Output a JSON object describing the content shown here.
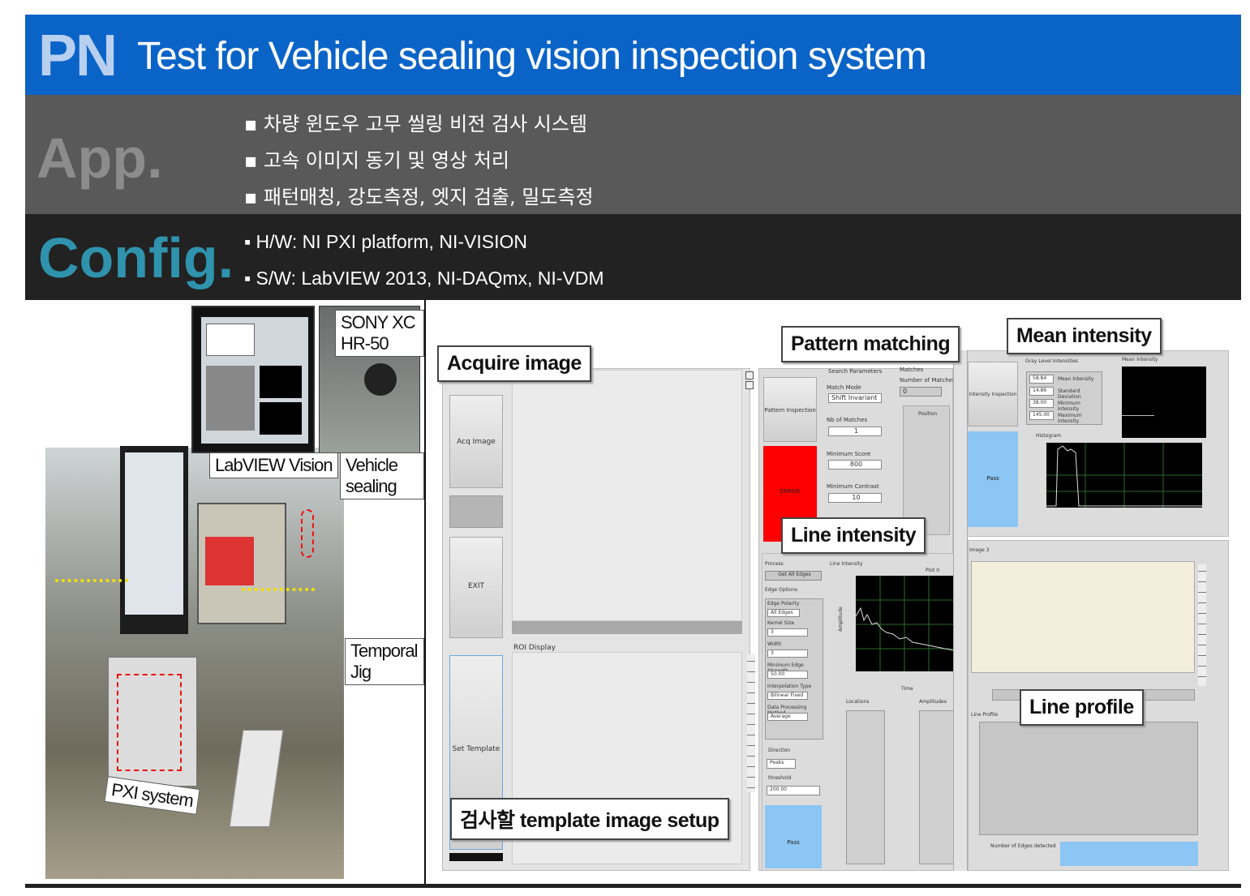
{
  "header": {
    "code": "PN",
    "title": "Test for Vehicle sealing vision inspection system"
  },
  "app": {
    "label": "App.",
    "items": [
      "▪ 차량 윈도우 고무 씰링 비전 검사 시스템",
      "▪ 고속 이미지 동기 및 영상 처리",
      "▪ 패턴매칭, 강도측정, 엣지 검출, 밀도측정"
    ]
  },
  "config": {
    "label": "Config.",
    "items": [
      "▪ H/W: NI PXI platform, NI-VISION",
      "▪ S/W: LabVIEW 2013, NI-DAQmx, NI-VDM"
    ]
  },
  "photo": {
    "callouts": {
      "camera": "SONY XC HR-50",
      "labview": "LabVIEW Vision",
      "sealing": "Vehicle sealing",
      "jig": "Temporal Jig",
      "pxi": "PXI system"
    }
  },
  "screen": {
    "callouts": {
      "acquire": "Acquire image",
      "pattern": "Pattern matching",
      "mean": "Mean intensity",
      "line": "Line intensity",
      "profile": "Line profile",
      "template": "검사할 template image setup"
    },
    "buttons": {
      "acq": "Acq Image",
      "exit": "EXIT",
      "set_template": "Set Template",
      "pattern_inspection": "Pattern Inspection",
      "intensity_inspection": "Intensity Inspection",
      "error": "ERROR",
      "pass": "Pass",
      "pass2": "Pass"
    },
    "roi_label": "ROI Display",
    "pattern": {
      "search_params": "Search Parameters",
      "match_mode": "Match Mode",
      "match_mode_val": "Shift Invariant",
      "nb_matches": "Nb of Matches",
      "nb_matches_val": "1",
      "min_score": "Minimum Score",
      "min_score_val": "800",
      "min_contrast": "Minimum Contrast",
      "min_contrast_val": "10",
      "matches": "Matches",
      "num_matches": "Number of Matches",
      "num_matches_val": "0",
      "position": "Position"
    },
    "mean": {
      "gray_levels": "Gray Level Intensities",
      "mean_label": "Mean Intensity",
      "stats": [
        {
          "value": "58.84",
          "label": "Mean Intensity"
        },
        {
          "value": "14.86",
          "label": "Standard Deviation"
        },
        {
          "value": "38.00",
          "label": "Minimum Intensity"
        },
        {
          "value": "145.00",
          "label": "Maximum Intensity"
        }
      ],
      "histogram": "Histogram"
    },
    "line": {
      "process": "Process",
      "process_val": "Get All Edges",
      "edge_options": "Edge Options",
      "edge_polarity": "Edge Polarity",
      "edge_polarity_val": "All Edges",
      "kernel": "Kernel Size",
      "kernel_val": "3",
      "width": "Width",
      "width_val": "3",
      "min_edge": "Minimum Edge Strength",
      "min_edge_val": "50.00",
      "interp": "Interpolation Type",
      "interp_val": "Bilinear Fixed",
      "data_proc": "Data Processing Method",
      "data_proc_val": "Average",
      "direction": "Direction",
      "direction_val": "Peaks",
      "threshold": "threshold",
      "threshold_val": "200.00",
      "line_intensity": "Line Intensity",
      "plot0": "Plot 0",
      "time": "Time",
      "amplitude": "Amplitude",
      "locations": "Locations",
      "amplitudes": "Amplitudes"
    },
    "profile": {
      "image_label": "Image 3",
      "line_profile": "Line Profile",
      "edges_detected": "Number of Edges detected"
    }
  }
}
